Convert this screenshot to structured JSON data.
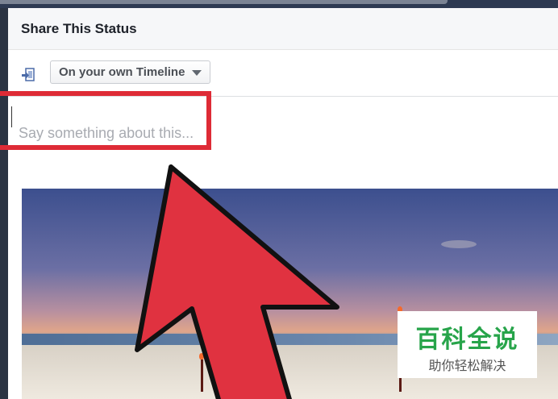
{
  "dialog": {
    "title": "Share This Status",
    "audience": {
      "icon": "share-timeline-icon",
      "selected": "On your own Timeline"
    },
    "composer": {
      "placeholder": "Say something about this..."
    },
    "preview": {
      "kind": "beach-sunset-photo"
    }
  },
  "annotation": {
    "highlight_color": "#de2b36",
    "arrow_color": "#e03240"
  },
  "watermark": {
    "main": "百科全说",
    "sub": "助你轻松解决",
    "color": "#27a44a"
  }
}
